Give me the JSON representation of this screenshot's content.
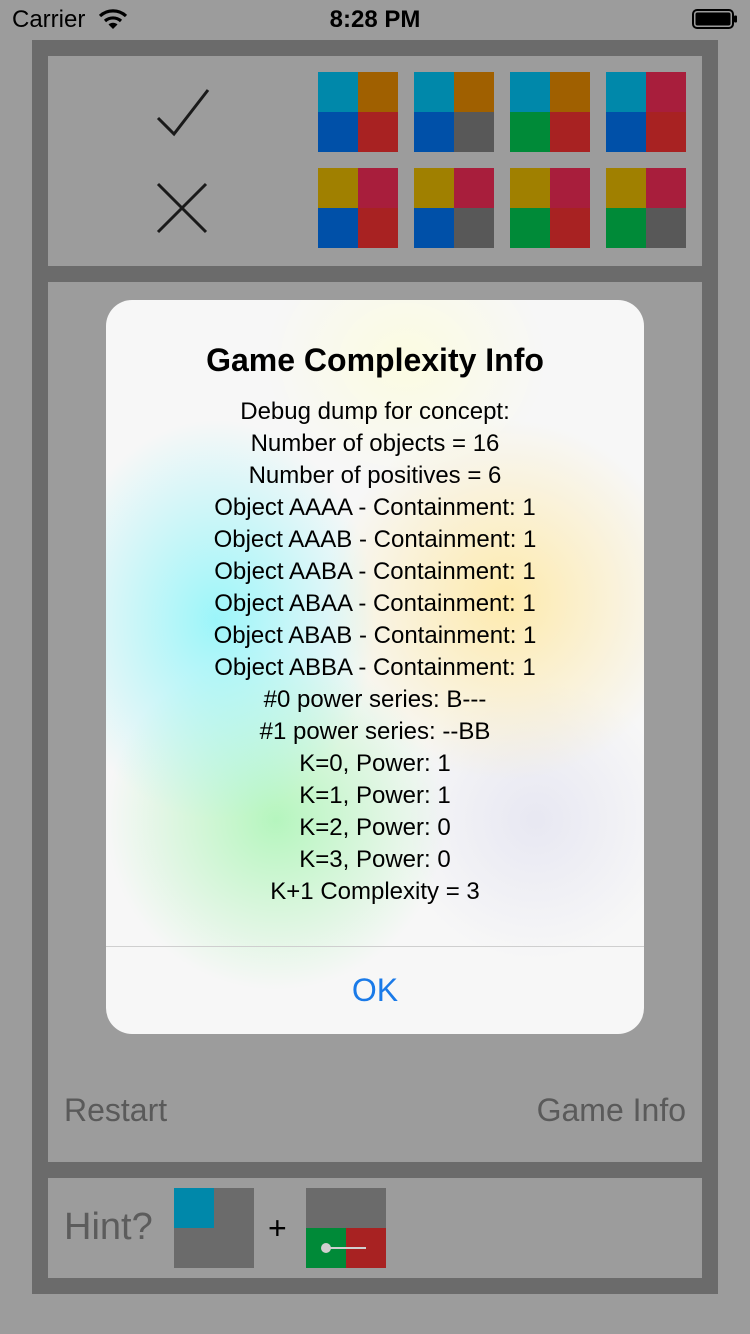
{
  "status": {
    "carrier": "Carrier",
    "time": "8:28 PM"
  },
  "colors": {
    "teal": "#0088aa",
    "orange": "#a06000",
    "blue": "#0050a8",
    "red": "#a82222",
    "gray": "#585858",
    "green": "#008a38",
    "olive": "#a08000",
    "crimson": "#a81e3c",
    "panel_gray": "#6b6b6b"
  },
  "examples": {
    "positive_icon": "checkmark-icon",
    "negative_icon": "cross-icon",
    "positive": [
      [
        "teal",
        "orange",
        "blue",
        "red"
      ],
      [
        "teal",
        "orange",
        "blue",
        "gray"
      ],
      [
        "teal",
        "orange",
        "green",
        "red"
      ],
      [
        "teal",
        "crimson",
        "blue",
        "red"
      ]
    ],
    "negative": [
      [
        "olive",
        "crimson",
        "blue",
        "red"
      ],
      [
        "olive",
        "crimson",
        "blue",
        "gray"
      ],
      [
        "olive",
        "crimson",
        "green",
        "red"
      ],
      [
        "olive",
        "crimson",
        "green",
        "gray"
      ]
    ]
  },
  "buttons": {
    "restart": "Restart",
    "game_info": "Game Info"
  },
  "hint": {
    "label": "Hint?",
    "plus": "+",
    "tile1": [
      "teal",
      "panel_gray",
      "panel_gray",
      "panel_gray"
    ],
    "tile2": [
      "panel_gray",
      "panel_gray",
      "green",
      "red"
    ],
    "slider_icon": "slider-handle-icon"
  },
  "alert": {
    "title": "Game Complexity Info",
    "lines": [
      "Debug dump for concept:",
      "Number of objects = 16",
      "Number of positives = 6",
      "Object AAAA - Containment: 1",
      "Object AAAB - Containment: 1",
      "Object AABA - Containment: 1",
      "Object ABAA - Containment: 1",
      "Object ABAB - Containment: 1",
      "Object ABBA - Containment: 1",
      "#0 power series: B---",
      "#1 power series: --BB",
      "K=0, Power: 1",
      "K=1, Power: 1",
      "K=2, Power: 0",
      "K=3, Power: 0",
      "K+1 Complexity = 3"
    ],
    "ok": "OK"
  }
}
